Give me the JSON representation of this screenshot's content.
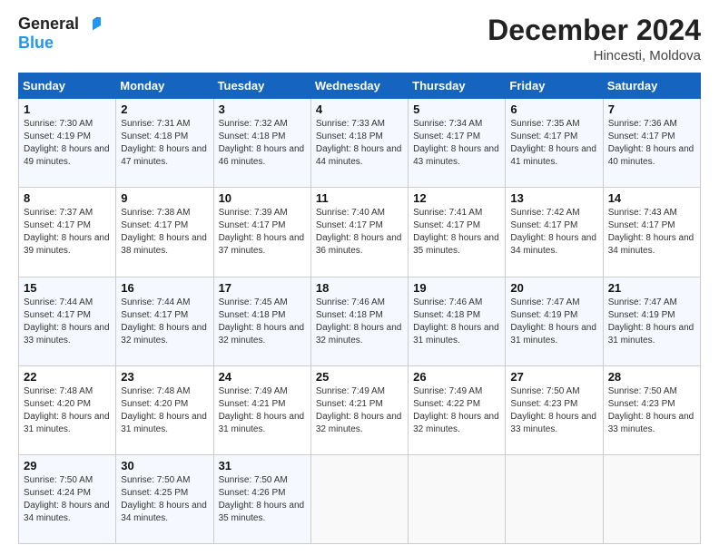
{
  "header": {
    "logo_line1": "General",
    "logo_line2": "Blue",
    "month": "December 2024",
    "location": "Hincesti, Moldova"
  },
  "weekdays": [
    "Sunday",
    "Monday",
    "Tuesday",
    "Wednesday",
    "Thursday",
    "Friday",
    "Saturday"
  ],
  "weeks": [
    [
      {
        "day": "1",
        "sunrise": "Sunrise: 7:30 AM",
        "sunset": "Sunset: 4:19 PM",
        "daylight": "Daylight: 8 hours and 49 minutes."
      },
      {
        "day": "2",
        "sunrise": "Sunrise: 7:31 AM",
        "sunset": "Sunset: 4:18 PM",
        "daylight": "Daylight: 8 hours and 47 minutes."
      },
      {
        "day": "3",
        "sunrise": "Sunrise: 7:32 AM",
        "sunset": "Sunset: 4:18 PM",
        "daylight": "Daylight: 8 hours and 46 minutes."
      },
      {
        "day": "4",
        "sunrise": "Sunrise: 7:33 AM",
        "sunset": "Sunset: 4:18 PM",
        "daylight": "Daylight: 8 hours and 44 minutes."
      },
      {
        "day": "5",
        "sunrise": "Sunrise: 7:34 AM",
        "sunset": "Sunset: 4:17 PM",
        "daylight": "Daylight: 8 hours and 43 minutes."
      },
      {
        "day": "6",
        "sunrise": "Sunrise: 7:35 AM",
        "sunset": "Sunset: 4:17 PM",
        "daylight": "Daylight: 8 hours and 41 minutes."
      },
      {
        "day": "7",
        "sunrise": "Sunrise: 7:36 AM",
        "sunset": "Sunset: 4:17 PM",
        "daylight": "Daylight: 8 hours and 40 minutes."
      }
    ],
    [
      {
        "day": "8",
        "sunrise": "Sunrise: 7:37 AM",
        "sunset": "Sunset: 4:17 PM",
        "daylight": "Daylight: 8 hours and 39 minutes."
      },
      {
        "day": "9",
        "sunrise": "Sunrise: 7:38 AM",
        "sunset": "Sunset: 4:17 PM",
        "daylight": "Daylight: 8 hours and 38 minutes."
      },
      {
        "day": "10",
        "sunrise": "Sunrise: 7:39 AM",
        "sunset": "Sunset: 4:17 PM",
        "daylight": "Daylight: 8 hours and 37 minutes."
      },
      {
        "day": "11",
        "sunrise": "Sunrise: 7:40 AM",
        "sunset": "Sunset: 4:17 PM",
        "daylight": "Daylight: 8 hours and 36 minutes."
      },
      {
        "day": "12",
        "sunrise": "Sunrise: 7:41 AM",
        "sunset": "Sunset: 4:17 PM",
        "daylight": "Daylight: 8 hours and 35 minutes."
      },
      {
        "day": "13",
        "sunrise": "Sunrise: 7:42 AM",
        "sunset": "Sunset: 4:17 PM",
        "daylight": "Daylight: 8 hours and 34 minutes."
      },
      {
        "day": "14",
        "sunrise": "Sunrise: 7:43 AM",
        "sunset": "Sunset: 4:17 PM",
        "daylight": "Daylight: 8 hours and 34 minutes."
      }
    ],
    [
      {
        "day": "15",
        "sunrise": "Sunrise: 7:44 AM",
        "sunset": "Sunset: 4:17 PM",
        "daylight": "Daylight: 8 hours and 33 minutes."
      },
      {
        "day": "16",
        "sunrise": "Sunrise: 7:44 AM",
        "sunset": "Sunset: 4:17 PM",
        "daylight": "Daylight: 8 hours and 32 minutes."
      },
      {
        "day": "17",
        "sunrise": "Sunrise: 7:45 AM",
        "sunset": "Sunset: 4:18 PM",
        "daylight": "Daylight: 8 hours and 32 minutes."
      },
      {
        "day": "18",
        "sunrise": "Sunrise: 7:46 AM",
        "sunset": "Sunset: 4:18 PM",
        "daylight": "Daylight: 8 hours and 32 minutes."
      },
      {
        "day": "19",
        "sunrise": "Sunrise: 7:46 AM",
        "sunset": "Sunset: 4:18 PM",
        "daylight": "Daylight: 8 hours and 31 minutes."
      },
      {
        "day": "20",
        "sunrise": "Sunrise: 7:47 AM",
        "sunset": "Sunset: 4:19 PM",
        "daylight": "Daylight: 8 hours and 31 minutes."
      },
      {
        "day": "21",
        "sunrise": "Sunrise: 7:47 AM",
        "sunset": "Sunset: 4:19 PM",
        "daylight": "Daylight: 8 hours and 31 minutes."
      }
    ],
    [
      {
        "day": "22",
        "sunrise": "Sunrise: 7:48 AM",
        "sunset": "Sunset: 4:20 PM",
        "daylight": "Daylight: 8 hours and 31 minutes."
      },
      {
        "day": "23",
        "sunrise": "Sunrise: 7:48 AM",
        "sunset": "Sunset: 4:20 PM",
        "daylight": "Daylight: 8 hours and 31 minutes."
      },
      {
        "day": "24",
        "sunrise": "Sunrise: 7:49 AM",
        "sunset": "Sunset: 4:21 PM",
        "daylight": "Daylight: 8 hours and 31 minutes."
      },
      {
        "day": "25",
        "sunrise": "Sunrise: 7:49 AM",
        "sunset": "Sunset: 4:21 PM",
        "daylight": "Daylight: 8 hours and 32 minutes."
      },
      {
        "day": "26",
        "sunrise": "Sunrise: 7:49 AM",
        "sunset": "Sunset: 4:22 PM",
        "daylight": "Daylight: 8 hours and 32 minutes."
      },
      {
        "day": "27",
        "sunrise": "Sunrise: 7:50 AM",
        "sunset": "Sunset: 4:23 PM",
        "daylight": "Daylight: 8 hours and 33 minutes."
      },
      {
        "day": "28",
        "sunrise": "Sunrise: 7:50 AM",
        "sunset": "Sunset: 4:23 PM",
        "daylight": "Daylight: 8 hours and 33 minutes."
      }
    ],
    [
      {
        "day": "29",
        "sunrise": "Sunrise: 7:50 AM",
        "sunset": "Sunset: 4:24 PM",
        "daylight": "Daylight: 8 hours and 34 minutes."
      },
      {
        "day": "30",
        "sunrise": "Sunrise: 7:50 AM",
        "sunset": "Sunset: 4:25 PM",
        "daylight": "Daylight: 8 hours and 34 minutes."
      },
      {
        "day": "31",
        "sunrise": "Sunrise: 7:50 AM",
        "sunset": "Sunset: 4:26 PM",
        "daylight": "Daylight: 8 hours and 35 minutes."
      },
      null,
      null,
      null,
      null
    ]
  ]
}
